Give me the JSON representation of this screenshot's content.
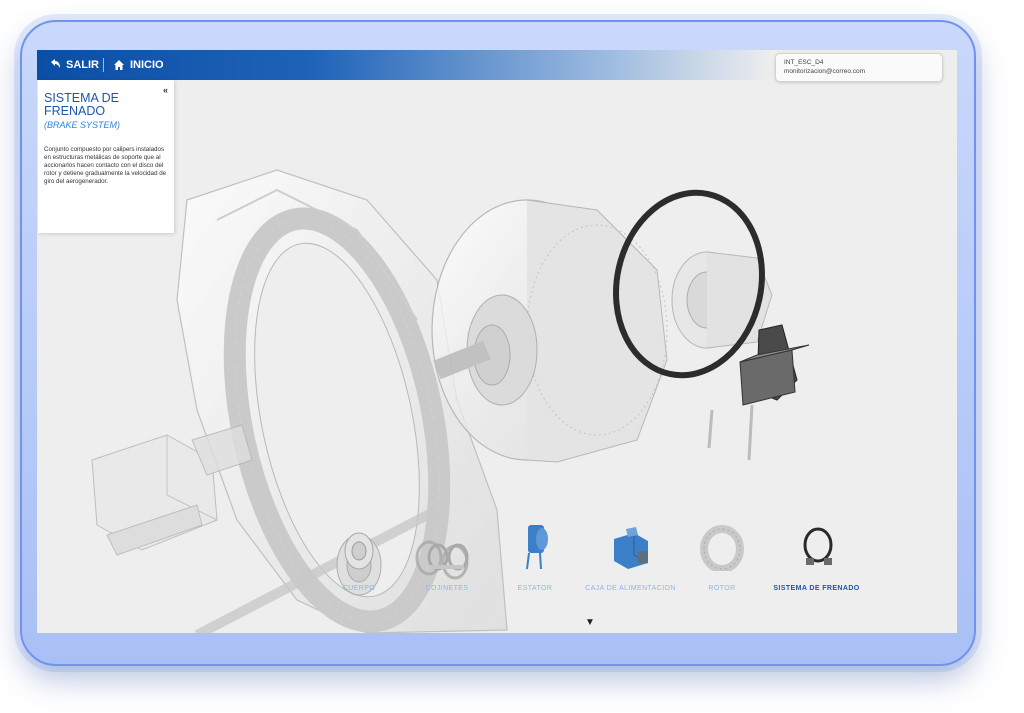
{
  "nav": {
    "exit_label": "SALIR",
    "home_label": "INICIO"
  },
  "user": {
    "line1": "INT_ESC_D4",
    "line2": "monitorizacion@correo.com"
  },
  "panel": {
    "collapse_icon": "«",
    "title": "SISTEMA DE FRENADO",
    "subtitle": "(BRAKE SYSTEM)",
    "description": "Conjunto compuesto por calipers instalados en estructuras metálicas de soporte que al accionarlos hacen contacto con el disco del rotor y detiene gradualmente la velocidad de giro del aerogenerador."
  },
  "components": [
    {
      "label": "CUERPO",
      "icon": "body-icon",
      "active": false
    },
    {
      "label": "COJINETES",
      "icon": "bearings-icon",
      "active": false
    },
    {
      "label": "ESTATOR",
      "icon": "stator-icon",
      "active": false
    },
    {
      "label": "CAJA DE ALIMENTACION",
      "icon": "feed-box-icon",
      "active": false
    },
    {
      "label": "ROTOR",
      "icon": "rotor-icon",
      "active": false
    },
    {
      "label": "SISTEMA DE FRENADO",
      "icon": "brake-icon",
      "active": true
    }
  ],
  "more_arrow": "▼",
  "colors": {
    "accent": "#1a58b0",
    "label_inactive": "#8fb6e6",
    "component_blue": "#3b7fc8"
  }
}
